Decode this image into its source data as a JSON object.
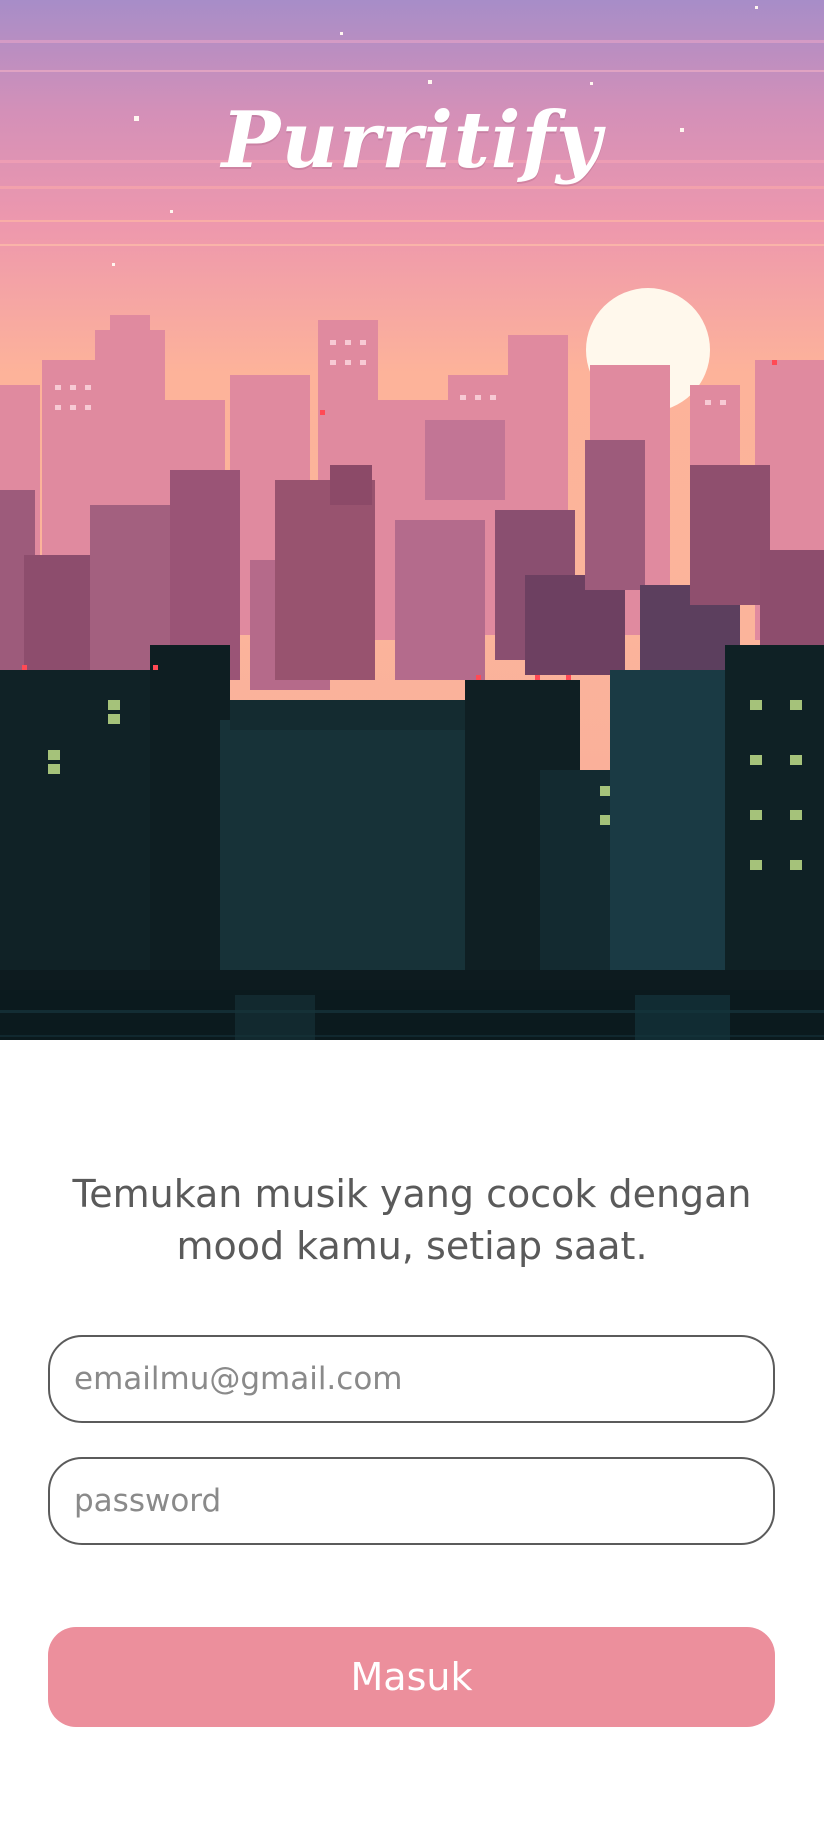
{
  "app": {
    "brand": "Purritify"
  },
  "intro": {
    "tagline": "Temukan musik yang cocok dengan mood kamu, setiap saat."
  },
  "login": {
    "email_placeholder": "emailmu@gmail.com",
    "password_placeholder": "password",
    "submit_label": "Masuk"
  },
  "colors": {
    "sky_top": "#a78dc8",
    "sky_mid": "#e896ad",
    "sky_low": "#fdb69a",
    "far_buildings": "#dc8098",
    "mid_buildings": "#8f4f6e",
    "near_buildings": "#102327",
    "button": "#ec8f9c"
  }
}
